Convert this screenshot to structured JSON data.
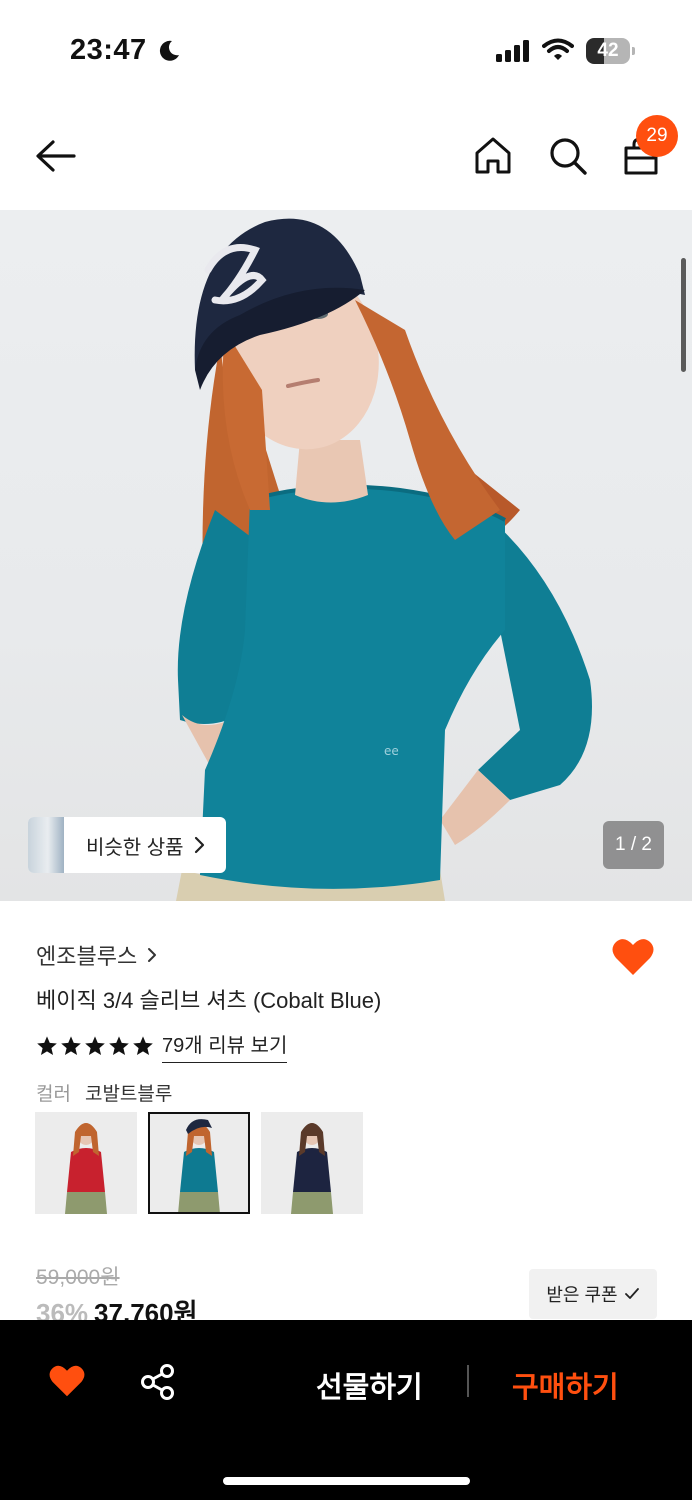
{
  "status_bar": {
    "time": "23:47",
    "battery": "42",
    "battery_level": 0.42
  },
  "nav": {
    "cart_count": "29"
  },
  "gallery": {
    "similar_label": "비슷한 상품",
    "counter": "1 / 2"
  },
  "product": {
    "brand": "엔조블루스",
    "title": "베이직 3/4 슬리브 셔츠 (Cobalt Blue)",
    "rating_stars": 5,
    "reviews_label": "79개 리뷰 보기",
    "color_key": "컬러",
    "color_value": "코발트블루",
    "swatches": [
      {
        "name": "red",
        "color": "#c8212e",
        "selected": false
      },
      {
        "name": "cobalt-blue",
        "color": "#0e7a91",
        "selected": true
      },
      {
        "name": "navy",
        "color": "#1d2440",
        "selected": false
      }
    ],
    "original_price": "59,000원",
    "discount": "36%",
    "price": "37,760원",
    "coupon_label": "받은 쿠폰"
  },
  "bottom_bar": {
    "gift_label": "선물하기",
    "buy_label": "구매하기"
  },
  "colors": {
    "accent": "#ff4f0f",
    "bar_bg": "#000000"
  }
}
